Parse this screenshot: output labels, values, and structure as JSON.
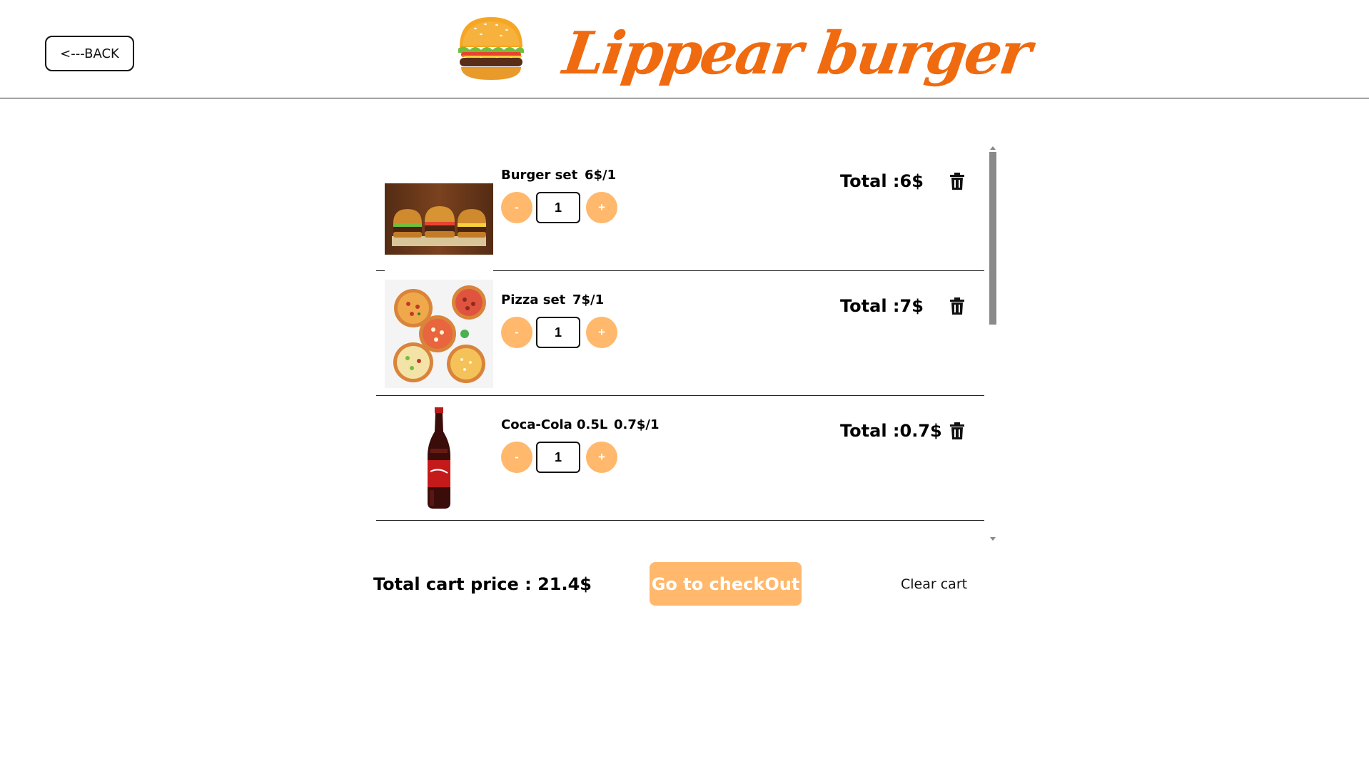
{
  "header": {
    "back_label": "<---BACK",
    "brand_name": "Lippear burger",
    "brand_color": "#f06a0f",
    "logo_icon": "burger-icon"
  },
  "cart": {
    "items": [
      {
        "name": "Burger set",
        "price": "6$/1",
        "quantity": "1",
        "total": "Total :6$",
        "minus": "-",
        "plus": "+",
        "image_icon": "burger-set-image"
      },
      {
        "name": "Pizza set",
        "price": "7$/1",
        "quantity": "1",
        "total": "Total :7$",
        "minus": "-",
        "plus": "+",
        "image_icon": "pizza-set-image"
      },
      {
        "name": "Coca-Cola 0.5L",
        "price": "0.7$/1",
        "quantity": "1",
        "total": "Total :0.7$",
        "minus": "-",
        "plus": "+",
        "image_icon": "cola-bottle-image"
      }
    ]
  },
  "footer": {
    "total_price": "Total cart price : 21.4$",
    "checkout_label": "Go to checkOut",
    "clear_label": "Clear cart"
  },
  "colors": {
    "accent": "#ffb86c",
    "brand": "#f06a0f"
  }
}
